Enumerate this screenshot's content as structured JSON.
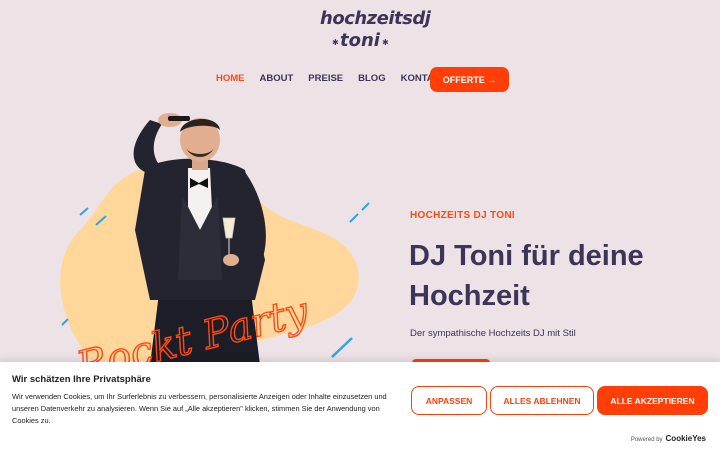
{
  "logo": {
    "line1": "hochzeitsdj",
    "line2": "toni"
  },
  "nav": {
    "items": [
      {
        "label": "HOME",
        "active": true
      },
      {
        "label": "ABOUT",
        "active": false
      },
      {
        "label": "PREISE",
        "active": false
      },
      {
        "label": "BLOG",
        "active": false
      },
      {
        "label": "KONTAKT",
        "active": false
      }
    ],
    "cta_label": "OFFERTE →"
  },
  "hero": {
    "eyebrow": "HOCHZEITS DJ TONI",
    "headline": "DJ Toni für deine Hochzeit",
    "subline": "Der sympathische Hochzeits DJ mit Stil",
    "art_text": "Rockt Party"
  },
  "cookie": {
    "title": "Wir schätzen Ihre Privatsphäre",
    "text": "Wir verwenden Cookies, um Ihr Surferlebnis zu verbessern, personalisierte Anzeigen oder Inhalte einzusetzen und unseren Datenverkehr zu analysieren. Wenn Sie auf „Alle akzeptieren\" klicken, stimmen Sie der Anwendung von Cookies zu.",
    "customize_label": "ANPASSEN",
    "reject_label": "ALLES ABLEHNEN",
    "accept_label": "ALLE AKZEPTIEREN",
    "powered_by": "Powered by",
    "powered_brand": "CookieYes"
  },
  "colors": {
    "accent": "#ff3e08",
    "text": "#3d3558",
    "background": "#ede2e6",
    "blob": "#ffd79a",
    "lines": "#2aa6e6"
  }
}
